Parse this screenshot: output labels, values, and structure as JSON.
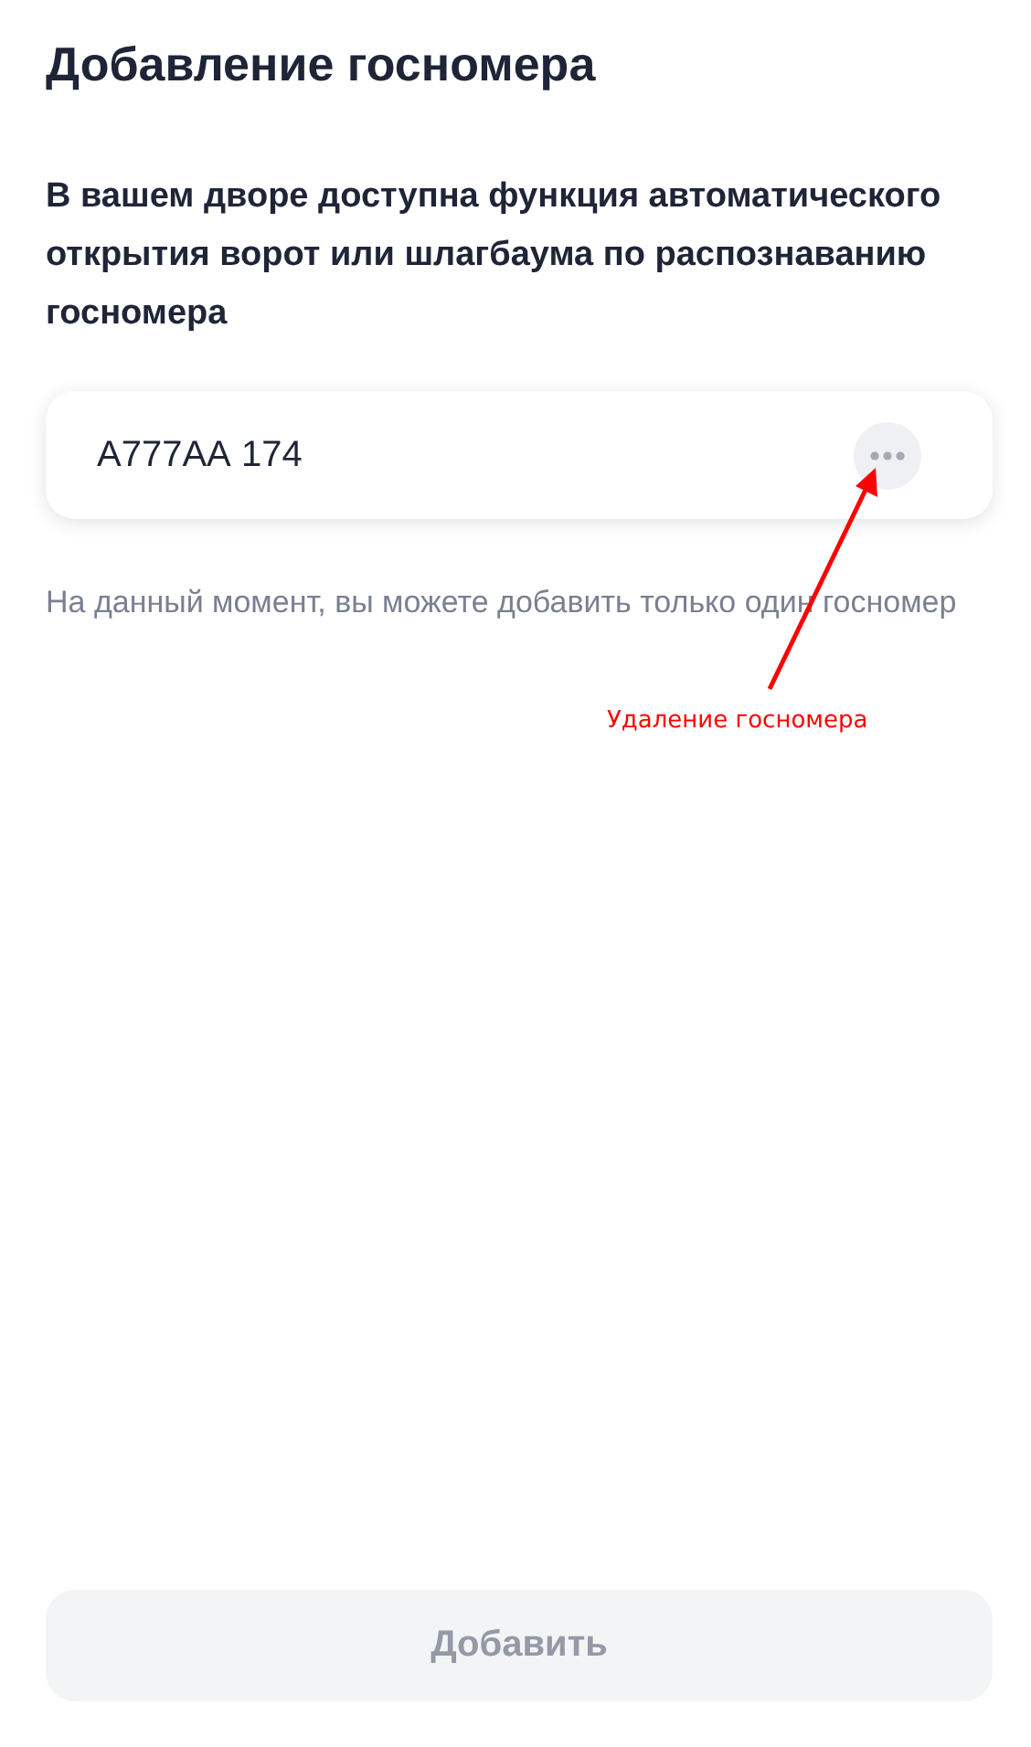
{
  "title": "Добавление госномера",
  "description": "В вашем дворе доступна функция автоматического открытия ворот или шлагбаума по распознаванию госномера",
  "plates": [
    {
      "number": "А777АА 174"
    }
  ],
  "note": "На данный момент, вы можете добавить только один госномер",
  "annotation": {
    "text": "Удаление госномера"
  },
  "button": {
    "label": "Добавить",
    "disabled": true
  }
}
